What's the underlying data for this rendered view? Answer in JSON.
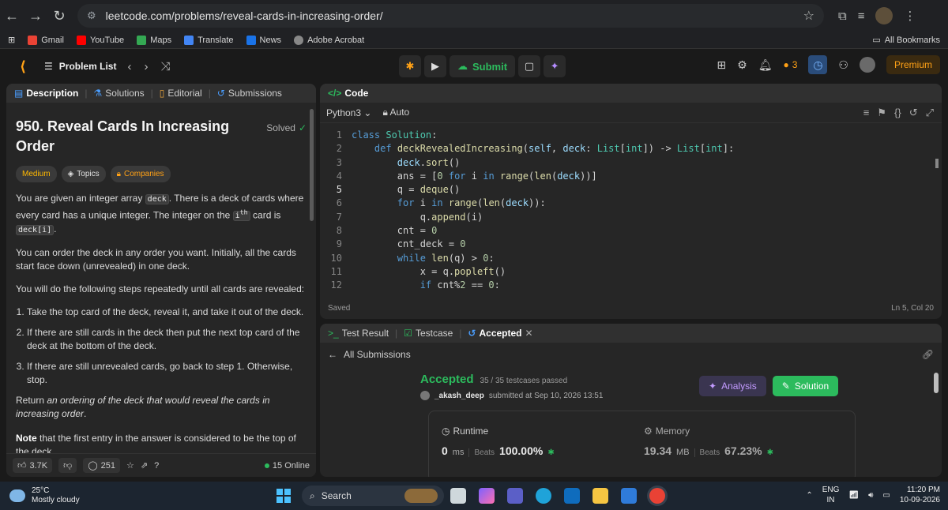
{
  "browser": {
    "url": "leetcode.com/problems/reveal-cards-in-increasing-order/",
    "bookmarks": [
      "Gmail",
      "YouTube",
      "Maps",
      "Translate",
      "News",
      "Adobe Acrobat"
    ],
    "all_bookmarks": "All Bookmarks"
  },
  "nav": {
    "problem_list": "Problem List",
    "submit": "Submit",
    "streak": "3",
    "premium": "Premium"
  },
  "left": {
    "tabs": [
      "Description",
      "Solutions",
      "Editorial",
      "Submissions"
    ],
    "title": "950. Reveal Cards In Increasing Order",
    "solved": "Solved",
    "chips": [
      "Medium",
      "Topics",
      "Companies"
    ],
    "p1_a": "You are given an integer array ",
    "p1_code1": "deck",
    "p1_b": ". There is a deck of cards where every card has a unique integer. The integer on the ",
    "p1_i": "i",
    "p1_sup": "th",
    "p1_c": " card is ",
    "p1_code2": "deck[i]",
    "p1_d": ".",
    "p2": "You can order the deck in any order you want. Initially, all the cards start face down (unrevealed) in one deck.",
    "p3": "You will do the following steps repeatedly until all cards are revealed:",
    "steps": [
      "Take the top card of the deck, reveal it, and take it out of the deck.",
      "If there are still cards in the deck then put the next top card of the deck at the bottom of the deck.",
      "If there are still unrevealed cards, go back to step 1. Otherwise, stop."
    ],
    "p4_a": "Return ",
    "p4_b": "an ordering of the deck that would reveal the cards in increasing order",
    "p4_c": ".",
    "p5_a": "Note",
    "p5_b": " that the first entry in the answer is considered to be the top of the deck.",
    "likes": "3.7K",
    "comments": "251",
    "online": "15 Online"
  },
  "code": {
    "tab": "Code",
    "language": "Python3",
    "mode": "Auto",
    "saved": "Saved",
    "cursor": "Ln 5, Col 20",
    "current_line": 5,
    "lines": [
      "class Solution:",
      "    def deckRevealedIncreasing(self, deck: List[int]) -> List[int]:",
      "        deck.sort()",
      "        ans = [0 for i in range(len(deck))]",
      "        q = deque()",
      "        for i in range(len(deck)):",
      "            q.append(i)",
      "        cnt = 0",
      "        cnt_deck = 0",
      "        while len(q) > 0:",
      "            x = q.popleft()",
      "            if cnt%2 == 0:"
    ]
  },
  "result": {
    "tabs": [
      "Test Result",
      "Testcase",
      "Accepted"
    ],
    "all_submissions": "All Submissions",
    "status": "Accepted",
    "testcases": "35 / 35 testcases passed",
    "user": "_akash_deep",
    "submitted_at": "submitted at Sep 10, 2026 13:51",
    "analysis": "Analysis",
    "solution": "Solution",
    "runtime": {
      "label": "Runtime",
      "value": "0",
      "unit": "ms",
      "beats_label": "Beats",
      "beats": "100.00%"
    },
    "memory": {
      "label": "Memory",
      "value": "19.34",
      "unit": "MB",
      "beats_label": "Beats",
      "beats": "67.23%"
    }
  },
  "taskbar": {
    "temp": "25°C",
    "weather": "Mostly cloudy",
    "search": "Search",
    "lang1": "ENG",
    "lang2": "IN",
    "time": "11:20 PM",
    "date": "10-09-2026"
  }
}
